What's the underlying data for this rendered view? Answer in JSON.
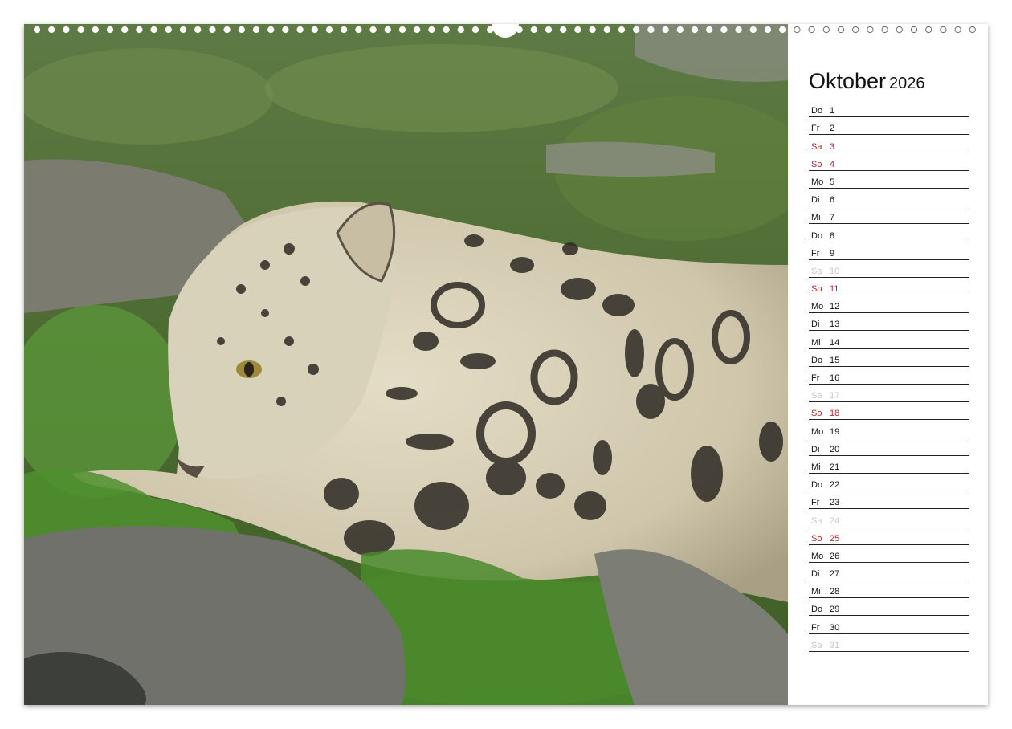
{
  "calendar": {
    "month": "Oktober",
    "year": "2026",
    "days": [
      {
        "dow": "Do",
        "day": "1",
        "kind": "normal"
      },
      {
        "dow": "Fr",
        "day": "2",
        "kind": "normal"
      },
      {
        "dow": "Sa",
        "day": "3",
        "kind": "sat"
      },
      {
        "dow": "So",
        "day": "4",
        "kind": "sun"
      },
      {
        "dow": "Mo",
        "day": "5",
        "kind": "normal"
      },
      {
        "dow": "Di",
        "day": "6",
        "kind": "normal"
      },
      {
        "dow": "Mi",
        "day": "7",
        "kind": "normal"
      },
      {
        "dow": "Do",
        "day": "8",
        "kind": "normal"
      },
      {
        "dow": "Fr",
        "day": "9",
        "kind": "normal"
      },
      {
        "dow": "Sa",
        "day": "10",
        "kind": "muted"
      },
      {
        "dow": "So",
        "day": "11",
        "kind": "sun"
      },
      {
        "dow": "Mo",
        "day": "12",
        "kind": "normal"
      },
      {
        "dow": "Di",
        "day": "13",
        "kind": "normal"
      },
      {
        "dow": "Mi",
        "day": "14",
        "kind": "normal"
      },
      {
        "dow": "Do",
        "day": "15",
        "kind": "normal"
      },
      {
        "dow": "Fr",
        "day": "16",
        "kind": "normal"
      },
      {
        "dow": "Sa",
        "day": "17",
        "kind": "muted"
      },
      {
        "dow": "So",
        "day": "18",
        "kind": "sun"
      },
      {
        "dow": "Mo",
        "day": "19",
        "kind": "normal"
      },
      {
        "dow": "Di",
        "day": "20",
        "kind": "normal"
      },
      {
        "dow": "Mi",
        "day": "21",
        "kind": "normal"
      },
      {
        "dow": "Do",
        "day": "22",
        "kind": "normal"
      },
      {
        "dow": "Fr",
        "day": "23",
        "kind": "normal"
      },
      {
        "dow": "Sa",
        "day": "24",
        "kind": "muted"
      },
      {
        "dow": "So",
        "day": "25",
        "kind": "sun"
      },
      {
        "dow": "Mo",
        "day": "26",
        "kind": "normal"
      },
      {
        "dow": "Di",
        "day": "27",
        "kind": "normal"
      },
      {
        "dow": "Mi",
        "day": "28",
        "kind": "normal"
      },
      {
        "dow": "Do",
        "day": "29",
        "kind": "normal"
      },
      {
        "dow": "Fr",
        "day": "30",
        "kind": "normal"
      },
      {
        "dow": "Sa",
        "day": "31",
        "kind": "muted"
      }
    ]
  },
  "photo": {
    "subject": "snow-leopard-icon"
  },
  "colors": {
    "weekend_red": "#c0262b",
    "muted_gray": "#c9c9c9",
    "grass_green": "#4f6e33"
  }
}
